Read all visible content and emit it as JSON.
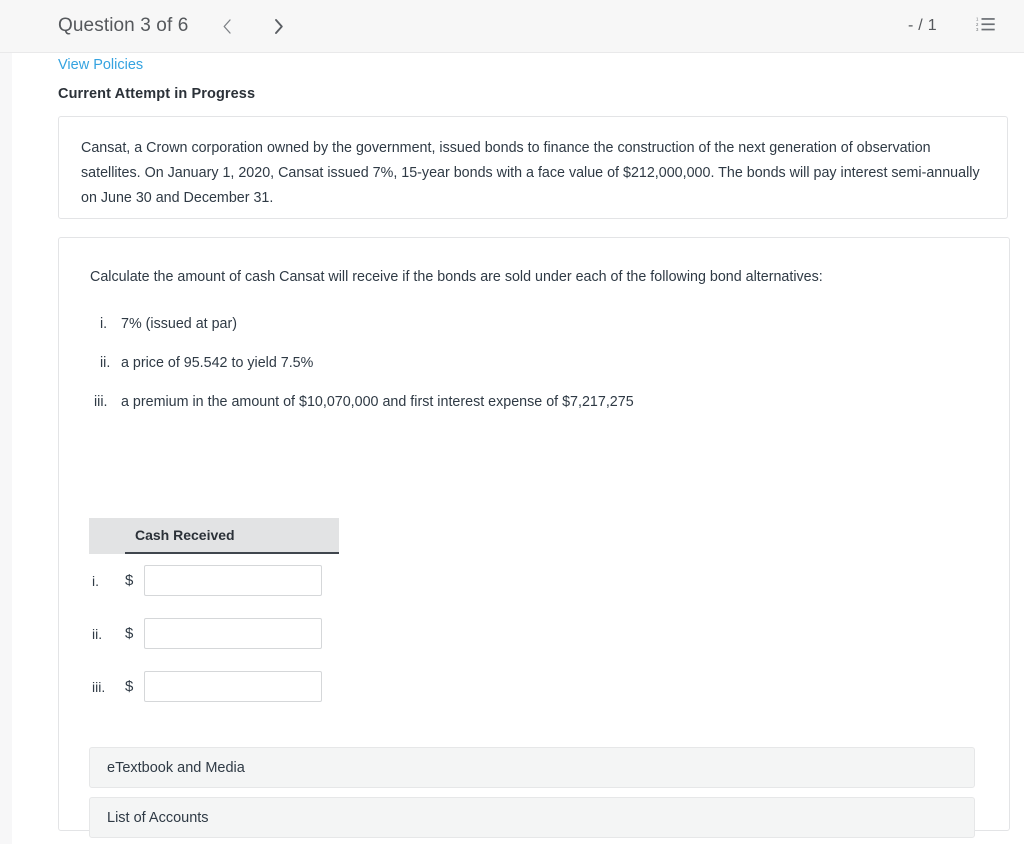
{
  "header": {
    "question_label": "Question 3 of 6",
    "prev_icon": "chevron-left-icon",
    "next_icon": "chevron-right-icon",
    "score": "- / 1",
    "list_icon": "numbered-list-icon"
  },
  "content": {
    "policies_link": "View Policies",
    "attempt_status": "Current Attempt in Progress",
    "scenario": "Cansat, a Crown corporation owned by the government, issued bonds to finance the construction of the next generation of observation satellites. On January 1, 2020, Cansat issued 7%, 15-year bonds with a face value of $212,000,000. The bonds will pay interest semi-annually on June 30 and December 31.",
    "prompt": "Calculate the amount of cash Cansat will receive if the bonds are sold under each of the following bond alternatives:",
    "alternatives": [
      {
        "num": "i.",
        "text": "7% (issued at par)"
      },
      {
        "num": "ii.",
        "text": "a price of 95.542 to yield 7.5%"
      },
      {
        "num": "iii.",
        "text": "a premium in the amount of $10,070,000 and first interest expense of $7,217,275"
      }
    ],
    "table": {
      "column_header": "Cash Received",
      "rows": [
        {
          "num": "i.",
          "currency": "$",
          "value": "",
          "placeholder": ""
        },
        {
          "num": "ii.",
          "currency": "$",
          "value": "",
          "placeholder": ""
        },
        {
          "num": "iii.",
          "currency": "$",
          "value": "",
          "placeholder": ""
        }
      ]
    },
    "accordions": [
      {
        "label": "eTextbook and Media"
      },
      {
        "label": "List of Accounts"
      }
    ]
  },
  "colors": {
    "link_blue": "#35a3e0",
    "header_bg": "#f7f7f7",
    "table_header_bg": "#e2e3e4",
    "accordion_bg": "#f4f5f5",
    "text_dark": "#2f3a45"
  }
}
